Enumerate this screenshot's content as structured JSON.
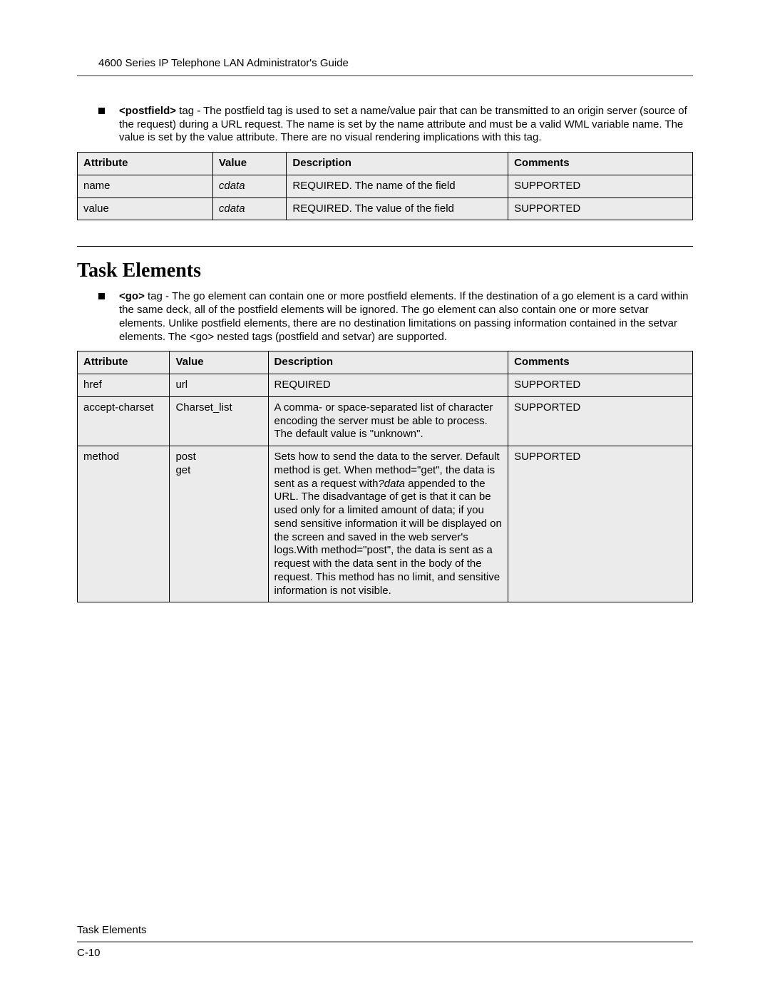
{
  "header": {
    "running_title": "4600 Series IP Telephone LAN Administrator's Guide"
  },
  "section1": {
    "bullet_lead": "<postfield>",
    "bullet_text": " tag - The postfield tag is used to set a name/value pair that can be transmitted to an origin server (source of the request) during a URL request. The name is set by the name attribute and must be a valid WML variable name. The value is set by the value attribute. There are no visual rendering implications with this tag.",
    "table": {
      "headers": {
        "c0": "Attribute",
        "c1": "Value",
        "c2": "Description",
        "c3": "Comments"
      },
      "rows": [
        {
          "c0": "name",
          "c1": "cdata",
          "c2": "REQUIRED. The name of the field",
          "c3": "SUPPORTED"
        },
        {
          "c0": "value",
          "c1": "cdata",
          "c2": "REQUIRED. The value of the field",
          "c3": "SUPPORTED"
        }
      ]
    }
  },
  "section2": {
    "heading": "Task Elements",
    "bullet_lead": "<go>",
    "bullet_text": " tag - The go element can contain one or more postfield elements. If the destination of a go element is a card within the same deck, all of the postfield elements will be ignored. The go element can also contain one or more setvar elements. Unlike postfield elements, there are no destination limitations on passing information contained in the setvar elements. The <go> nested tags (postfield and setvar) are supported.",
    "table": {
      "headers": {
        "c0": "Attribute",
        "c1": "Value",
        "c2": "Description",
        "c3": "Comments"
      },
      "rows": [
        {
          "c0": "href",
          "c1": "url",
          "c2": "REQUIRED",
          "c3": "SUPPORTED"
        },
        {
          "c0": "accept-charset",
          "c1": "Charset_list",
          "c2": "A comma- or space-separated list of character encoding the server must be able to process. The default value is \"unknown\".",
          "c3": "SUPPORTED"
        },
        {
          "c0": "method",
          "c1": "post\nget",
          "c2_pre": "Sets how to send the data to the server. Default method is get. When method=\"get\", the data is sent as a request with",
          "c2_ital": "?data",
          "c2_post": " appended to the URL. The disadvantage of get is that it can be used only for a limited amount of data; if you send sensitive information it will be displayed on the screen and saved in the web server's logs.With method=\"post\", the data is sent as a request with the data sent in the body of the request. This method has no limit, and sensitive information is not visible.",
          "c3": "SUPPORTED"
        }
      ]
    }
  },
  "footer": {
    "section_label": "Task Elements",
    "page_number": "C-10"
  }
}
